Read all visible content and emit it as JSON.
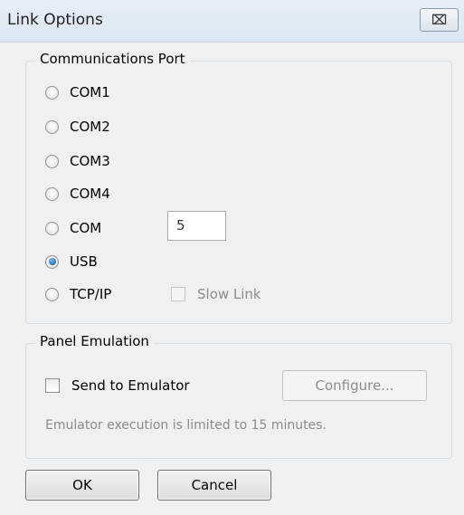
{
  "window": {
    "title": "Link Options",
    "close_glyph": "⌧"
  },
  "comm_port": {
    "legend": "Communications Port",
    "options": [
      {
        "label": "COM1",
        "checked": false
      },
      {
        "label": "COM2",
        "checked": false
      },
      {
        "label": "COM3",
        "checked": false
      },
      {
        "label": "COM4",
        "checked": false
      },
      {
        "label": "COM",
        "checked": false
      },
      {
        "label": "USB",
        "checked": true
      },
      {
        "label": "TCP/IP",
        "checked": false
      }
    ],
    "com_number_value": "5",
    "slow_link_label": "Slow Link",
    "slow_link_checked": false,
    "slow_link_enabled": false
  },
  "panel_emulation": {
    "legend": "Panel Emulation",
    "send_to_emulator_label": "Send to Emulator",
    "send_to_emulator_checked": false,
    "configure_label": "Configure...",
    "configure_enabled": false,
    "note": "Emulator execution is limited to 15 minutes."
  },
  "footer": {
    "ok_label": "OK",
    "cancel_label": "Cancel"
  },
  "colors": {
    "selected_radio": "#1c6fb8",
    "disabled_text": "#8c8c8c"
  }
}
